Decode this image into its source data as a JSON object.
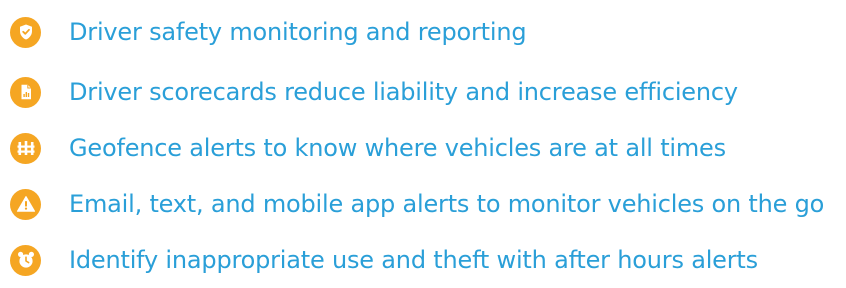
{
  "colors": {
    "icon_background": "#f5a623",
    "text": "#2a9fd8"
  },
  "features": [
    {
      "icon": "shield-check-icon",
      "text": "Driver safety monitoring and reporting"
    },
    {
      "icon": "report-chart-icon",
      "text": "Driver scorecards reduce liability and increase efficiency"
    },
    {
      "icon": "fence-icon",
      "text": "Geofence alerts to know where vehicles are at all times"
    },
    {
      "icon": "warning-triangle-icon",
      "text": "Email, text, and mobile app alerts to monitor vehicles on the go"
    },
    {
      "icon": "alarm-clock-icon",
      "text": "Identify inappropriate use and theft with after hours alerts"
    }
  ]
}
